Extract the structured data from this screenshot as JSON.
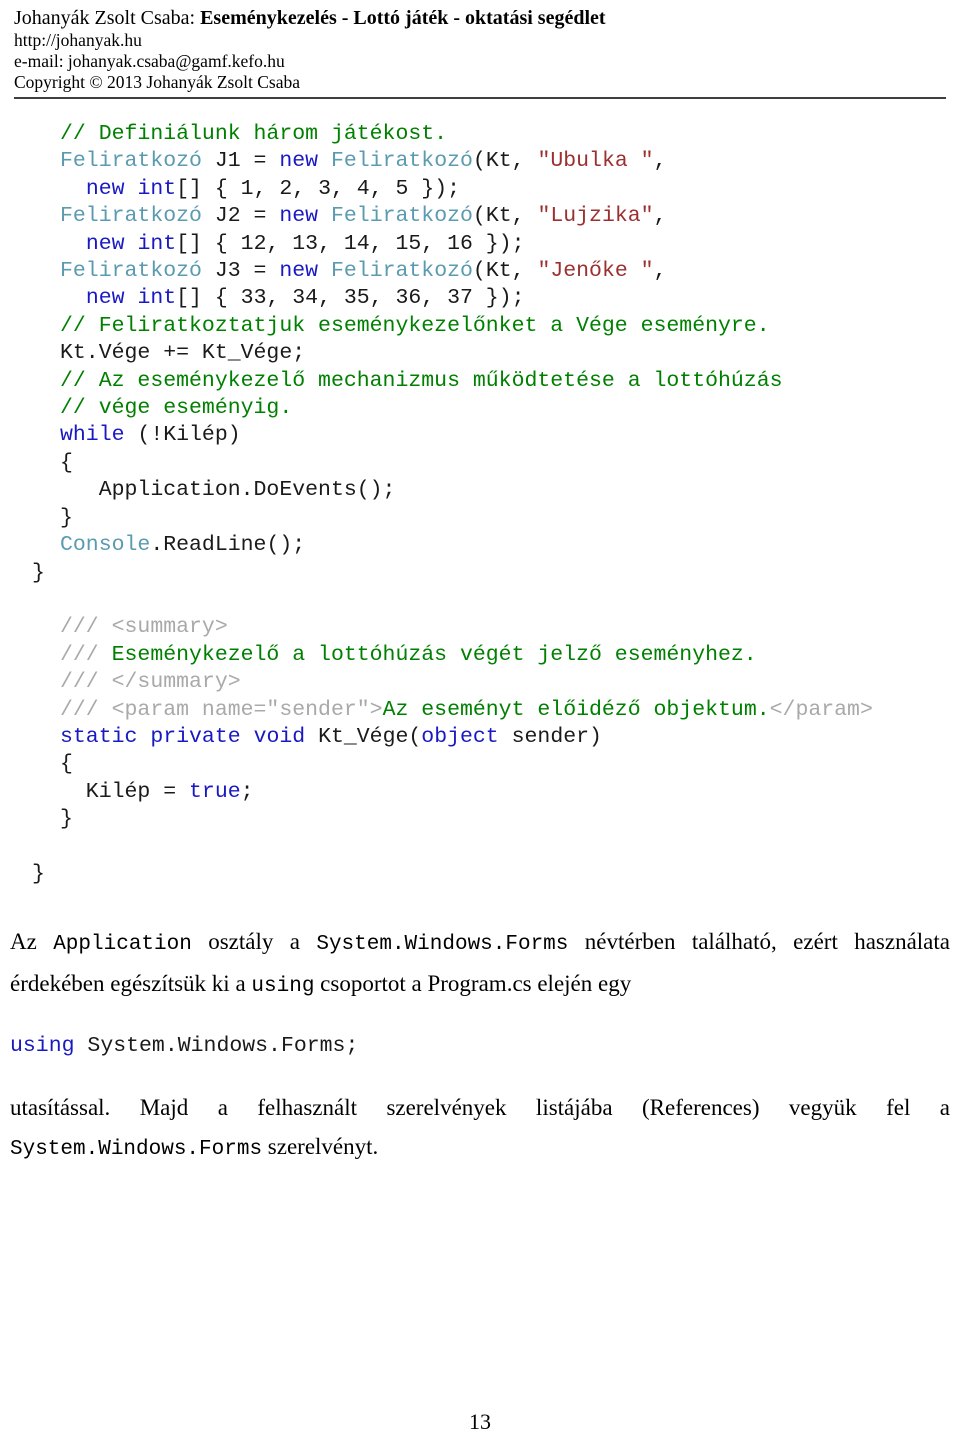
{
  "header": {
    "author_prefix": "Johanyák Zsolt Csaba:",
    "title": "Eseménykezelés - Lottó játék - oktatási segédlet",
    "url": "http://johanyak.hu",
    "email": "e-mail: johanyak.csaba@gamf.kefo.hu",
    "copyright": "Copyright © 2013 Johanyák Zsolt Csaba"
  },
  "code": {
    "lines": [
      [
        {
          "t": "// Definiálunk három játékost.",
          "c": "cmt"
        }
      ],
      [
        {
          "t": "Feliratkozó",
          "c": "typ"
        },
        {
          "t": " J1 = ",
          "c": "pln"
        },
        {
          "t": "new",
          "c": "kw"
        },
        {
          "t": " ",
          "c": "pln"
        },
        {
          "t": "Feliratkozó",
          "c": "typ"
        },
        {
          "t": "(Kt, ",
          "c": "pln"
        },
        {
          "t": "\"Ubulka \"",
          "c": "str"
        },
        {
          "t": ",",
          "c": "pln"
        }
      ],
      [
        {
          "t": "  ",
          "c": "pln"
        },
        {
          "t": "new",
          "c": "kw"
        },
        {
          "t": " ",
          "c": "pln"
        },
        {
          "t": "int",
          "c": "kw"
        },
        {
          "t": "[] { 1, 2, 3, 4, 5 });",
          "c": "pln"
        }
      ],
      [
        {
          "t": "Feliratkozó",
          "c": "typ"
        },
        {
          "t": " J2 = ",
          "c": "pln"
        },
        {
          "t": "new",
          "c": "kw"
        },
        {
          "t": " ",
          "c": "pln"
        },
        {
          "t": "Feliratkozó",
          "c": "typ"
        },
        {
          "t": "(Kt, ",
          "c": "pln"
        },
        {
          "t": "\"Lujzika\"",
          "c": "str"
        },
        {
          "t": ",",
          "c": "pln"
        }
      ],
      [
        {
          "t": "  ",
          "c": "pln"
        },
        {
          "t": "new",
          "c": "kw"
        },
        {
          "t": " ",
          "c": "pln"
        },
        {
          "t": "int",
          "c": "kw"
        },
        {
          "t": "[] { 12, 13, 14, 15, 16 });",
          "c": "pln"
        }
      ],
      [
        {
          "t": "Feliratkozó",
          "c": "typ"
        },
        {
          "t": " J3 = ",
          "c": "pln"
        },
        {
          "t": "new",
          "c": "kw"
        },
        {
          "t": " ",
          "c": "pln"
        },
        {
          "t": "Feliratkozó",
          "c": "typ"
        },
        {
          "t": "(Kt, ",
          "c": "pln"
        },
        {
          "t": "\"Jenőke \"",
          "c": "str"
        },
        {
          "t": ",",
          "c": "pln"
        }
      ],
      [
        {
          "t": "  ",
          "c": "pln"
        },
        {
          "t": "new",
          "c": "kw"
        },
        {
          "t": " ",
          "c": "pln"
        },
        {
          "t": "int",
          "c": "kw"
        },
        {
          "t": "[] { 33, 34, 35, 36, 37 });",
          "c": "pln"
        }
      ],
      [
        {
          "t": "// Feliratkoztatjuk eseménykezelőnket a Vége eseményre.",
          "c": "cmt"
        }
      ],
      [
        {
          "t": "Kt.Vége += Kt_Vége;",
          "c": "pln"
        }
      ],
      [
        {
          "t": "// Az eseménykezelő mechanizmus működtetése a lottóhúzás",
          "c": "cmt"
        }
      ],
      [
        {
          "t": "// vége eseményig.",
          "c": "cmt"
        }
      ],
      [
        {
          "t": "while",
          "c": "kw"
        },
        {
          "t": " (!Kilép)",
          "c": "pln"
        }
      ],
      [
        {
          "t": "{",
          "c": "pln"
        }
      ],
      [
        {
          "t": "   Application.DoEvents();",
          "c": "pln"
        }
      ],
      [
        {
          "t": "}",
          "c": "pln"
        }
      ],
      [
        {
          "t": "Console",
          "c": "typ"
        },
        {
          "t": ".ReadLine();",
          "c": "pln"
        }
      ],
      [
        {
          "t": "}",
          "c": "pln",
          "outdent": true
        }
      ],
      [
        {
          "t": "",
          "c": "pln"
        }
      ],
      [
        {
          "t": "/// ",
          "c": "xml"
        },
        {
          "t": "<summary>",
          "c": "xml"
        }
      ],
      [
        {
          "t": "/// ",
          "c": "xml"
        },
        {
          "t": "Eseménykezelő a lottóhúzás végét jelző eseményhez.",
          "c": "cmt"
        }
      ],
      [
        {
          "t": "/// ",
          "c": "xml"
        },
        {
          "t": "</summary>",
          "c": "xml"
        }
      ],
      [
        {
          "t": "/// ",
          "c": "xml"
        },
        {
          "t": "<param name=\"sender\">",
          "c": "xml"
        },
        {
          "t": "Az eseményt előidéző objektum.",
          "c": "cmt"
        },
        {
          "t": "</param>",
          "c": "xml"
        }
      ],
      [
        {
          "t": "static",
          "c": "kw"
        },
        {
          "t": " ",
          "c": "pln"
        },
        {
          "t": "private",
          "c": "kw"
        },
        {
          "t": " ",
          "c": "pln"
        },
        {
          "t": "void",
          "c": "kw"
        },
        {
          "t": " Kt_Vége(",
          "c": "pln"
        },
        {
          "t": "object",
          "c": "kw"
        },
        {
          "t": " sender)",
          "c": "pln"
        }
      ],
      [
        {
          "t": "{",
          "c": "pln"
        }
      ],
      [
        {
          "t": "  Kilép = ",
          "c": "pln"
        },
        {
          "t": "true",
          "c": "kw"
        },
        {
          "t": ";",
          "c": "pln"
        }
      ],
      [
        {
          "t": "}",
          "c": "pln"
        }
      ],
      [
        {
          "t": "",
          "c": "pln"
        }
      ],
      [
        {
          "t": "}",
          "c": "pln",
          "outdent": true
        }
      ]
    ]
  },
  "body": {
    "para1_parts": [
      {
        "t": "Az ",
        "m": false
      },
      {
        "t": "Application",
        "m": true
      },
      {
        "t": " osztály a ",
        "m": false
      },
      {
        "t": "System.Windows.Forms",
        "m": true
      },
      {
        "t": " névtérben található, ezért használata érdekében egészítsük ki a ",
        "m": false
      },
      {
        "t": "using",
        "m": true
      },
      {
        "t": " csoportot a Program.cs elején egy",
        "m": false
      }
    ],
    "code_snippet": [
      {
        "t": "using",
        "c": "kw"
      },
      {
        "t": " System.Windows.Forms;",
        "c": "pln"
      }
    ],
    "para2_parts": [
      {
        "t": "utasítással. Majd a felhasznált szerelvények listájába (References) vegyük fel a ",
        "m": false
      },
      {
        "t": "System.Windows.Forms",
        "m": true
      },
      {
        "t": " szerelvényt.",
        "m": false
      }
    ]
  },
  "footer": {
    "page_number": "13"
  },
  "colors": {
    "comment": "#008000",
    "keyword": "#1919c4",
    "type": "#5a9bb0",
    "string": "#9c2f2f",
    "xml_tag": "#a9a9a9",
    "plain": "#1a1a1a",
    "rule": "#3f3f3f"
  }
}
